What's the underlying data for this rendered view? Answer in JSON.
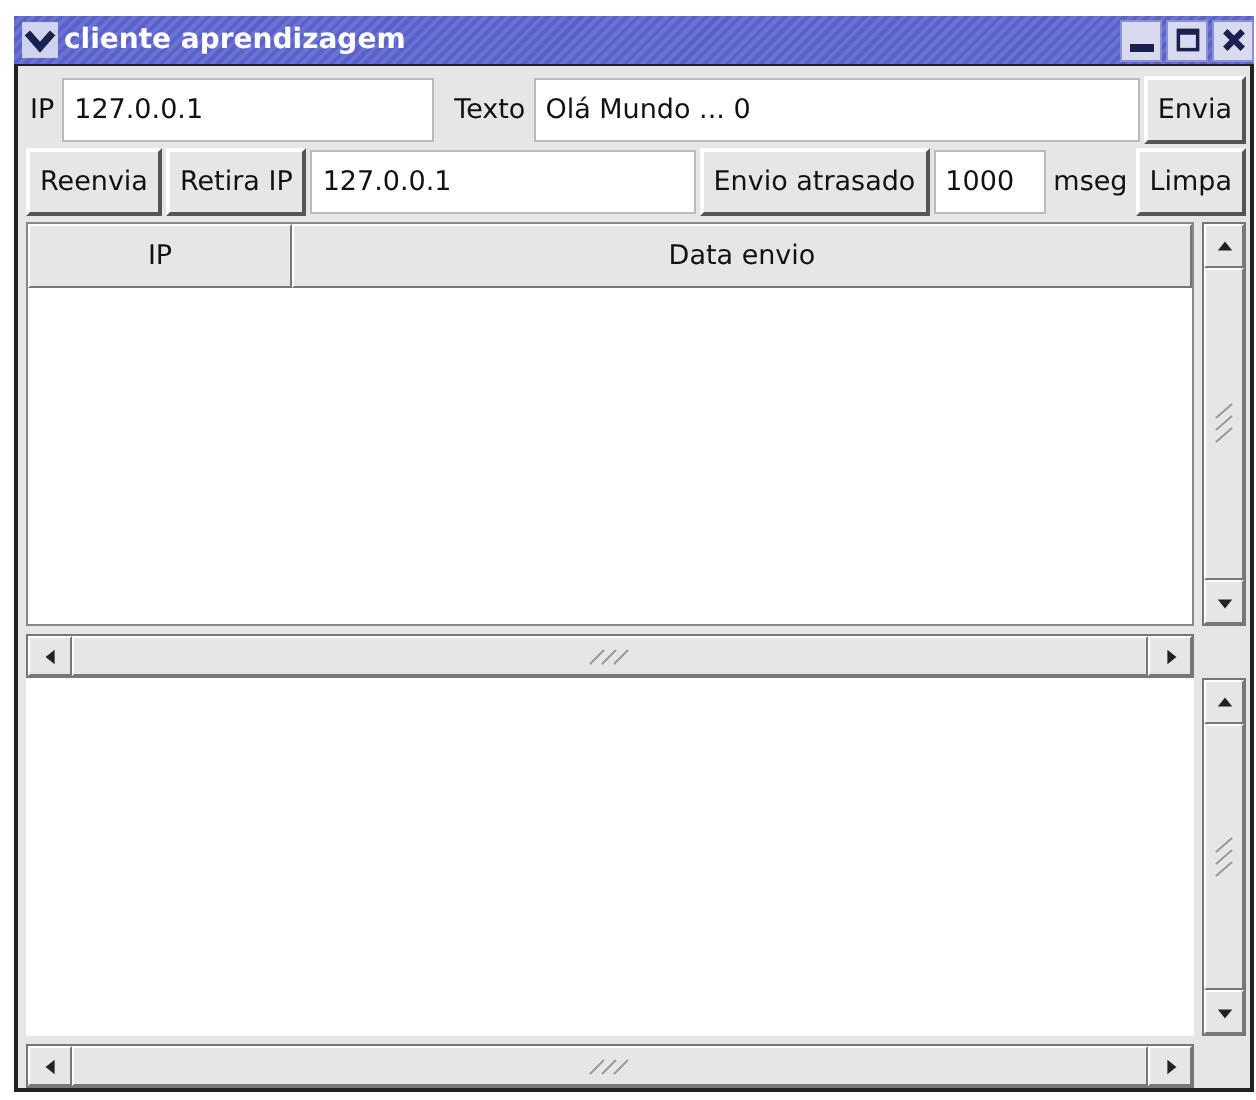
{
  "window": {
    "title": "cliente aprendizagem"
  },
  "row1": {
    "ip_label": "IP",
    "ip_value": "127.0.0.1",
    "text_label": "Texto",
    "text_value": "Olá Mundo ... 0",
    "send_button": "Envia"
  },
  "row2": {
    "resend_button": "Reenvia",
    "remove_ip_button": "Retira IP",
    "ip_value": "127.0.0.1",
    "delayed_button": "Envio atrasado",
    "delay_value": "1000",
    "delay_unit": "mseg",
    "clear_button": "Limpa"
  },
  "table": {
    "columns": [
      "IP",
      "Data envio"
    ]
  }
}
